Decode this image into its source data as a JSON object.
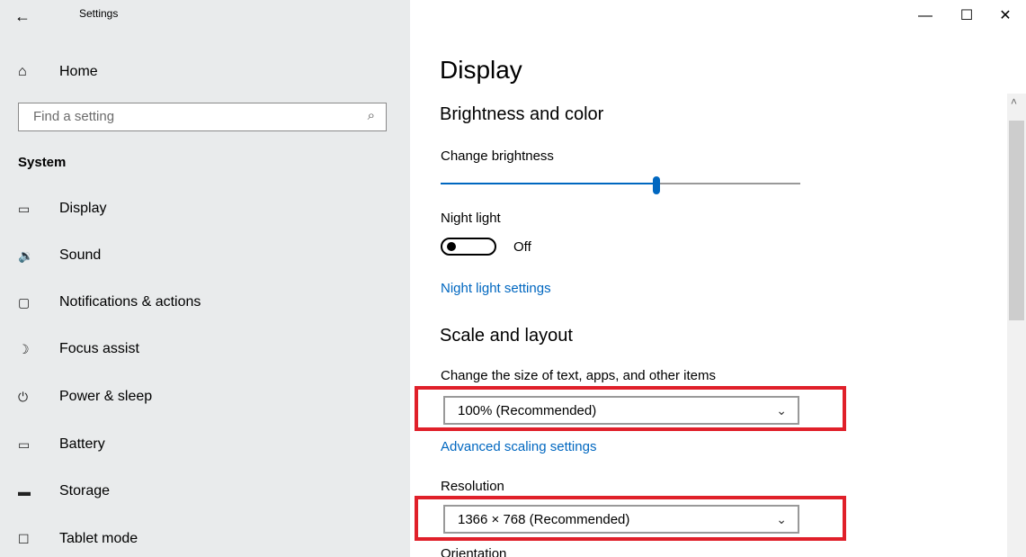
{
  "window": {
    "app_title": "Settings",
    "back_icon": "←",
    "minimize_icon": "—",
    "maximize_icon": "☐",
    "close_icon": "✕"
  },
  "sidebar": {
    "home": {
      "icon": "⌂",
      "label": "Home"
    },
    "search": {
      "placeholder": "Find a setting",
      "icon": "⌕"
    },
    "section": "System",
    "items": [
      {
        "icon": "▭",
        "label": "Display"
      },
      {
        "icon": "🔉",
        "label": "Sound"
      },
      {
        "icon": "▢",
        "label": "Notifications & actions"
      },
      {
        "icon": "☽",
        "label": "Focus assist"
      },
      {
        "icon": "⏻",
        "label": "Power & sleep"
      },
      {
        "icon": "▭",
        "label": "Battery"
      },
      {
        "icon": "▬",
        "label": "Storage"
      },
      {
        "icon": "☐",
        "label": "Tablet mode"
      }
    ]
  },
  "main": {
    "title": "Display",
    "brightness_section": "Brightness and color",
    "brightness_label": "Change brightness",
    "brightness_level": 0.6,
    "night_light_label": "Night light",
    "night_light_state": "Off",
    "night_light_link": "Night light settings",
    "scale_section": "Scale and layout",
    "scale_label": "Change the size of text, apps, and other items",
    "scale_value": "100% (Recommended)",
    "advanced_link": "Advanced scaling settings",
    "resolution_label": "Resolution",
    "resolution_value": "1366 × 768 (Recommended)",
    "orientation_label": "Orientation",
    "chevron": "⌵",
    "scroll_up": "˄"
  },
  "colors": {
    "accent": "#0067c0",
    "highlight": "#e0202a",
    "sidebar_bg": "#e9ebec"
  }
}
